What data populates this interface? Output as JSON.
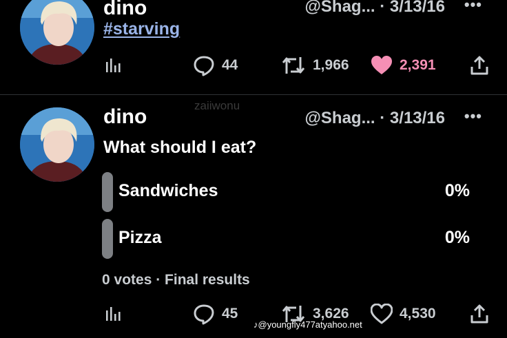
{
  "tweets": [
    {
      "name": "dino",
      "handle_date": "@Shag... · 3/13/16",
      "more": "•••",
      "hashtag": "#starving",
      "stats": {
        "replies": "44",
        "retweets": "1,966",
        "likes": "2,391"
      },
      "liked": true
    },
    {
      "name": "dino",
      "handle_date": "@Shag... · 3/13/16",
      "more": "•••",
      "text": "What should I eat?",
      "poll": {
        "options": [
          {
            "label": "Sandwiches",
            "percent": "0%"
          },
          {
            "label": "Pizza",
            "percent": "0%"
          }
        ],
        "meta": "0 votes · Final results"
      },
      "stats": {
        "replies": "45",
        "retweets": "3,626",
        "likes": "4,530"
      },
      "liked": false
    }
  ],
  "watermark": "zaiiwonu",
  "tiktok_credit": "@youngfly477atyahoo.net",
  "colors": {
    "background": "#000000",
    "like_pink": "#f58fb5",
    "hashtag": "#9ab4e8",
    "poll_bar": "#7d8084"
  },
  "icons": [
    "analytics-icon",
    "reply-icon",
    "retweet-icon",
    "heart-icon",
    "share-icon",
    "tiktok-icon"
  ]
}
